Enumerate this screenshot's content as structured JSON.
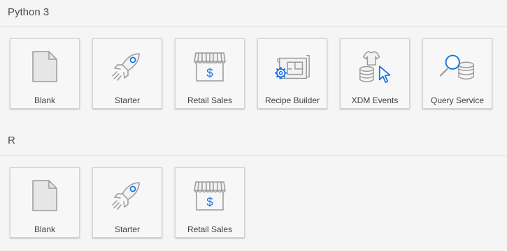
{
  "sections": [
    {
      "title": "Python 3",
      "tiles": [
        {
          "label": "Blank",
          "icon": "blank-document-icon"
        },
        {
          "label": "Starter",
          "icon": "rocket-icon"
        },
        {
          "label": "Retail Sales",
          "icon": "storefront-dollar-icon"
        },
        {
          "label": "Recipe Builder",
          "icon": "blueprint-gear-icon"
        },
        {
          "label": "XDM Events",
          "icon": "shirt-database-cursor-icon"
        },
        {
          "label": "Query Service",
          "icon": "magnifier-database-icon"
        }
      ]
    },
    {
      "title": "R",
      "tiles": [
        {
          "label": "Blank",
          "icon": "blank-document-icon"
        },
        {
          "label": "Starter",
          "icon": "rocket-icon"
        },
        {
          "label": "Retail Sales",
          "icon": "storefront-dollar-icon"
        }
      ]
    }
  ],
  "colors": {
    "accent": "#1473e6",
    "icon_gray": "#959595",
    "background": "#f5f5f5"
  }
}
